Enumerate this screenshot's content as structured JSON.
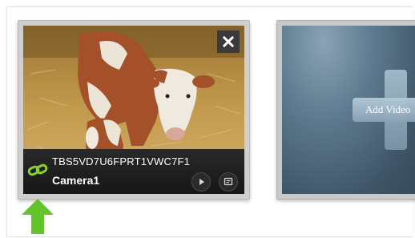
{
  "camera_tile": {
    "serial": "TBS5VD7U6FPRT1VWC7F1",
    "name": "Camera1",
    "link_icon": "link-icon",
    "close_icon": "close-icon",
    "play_icon": "play-icon",
    "details_icon": "details-icon"
  },
  "add_tile": {
    "label": "Add Video"
  },
  "colors": {
    "link_green": "#8bd12a",
    "arrow_green": "#62c42a",
    "info_bar": "#1c1c1c"
  }
}
